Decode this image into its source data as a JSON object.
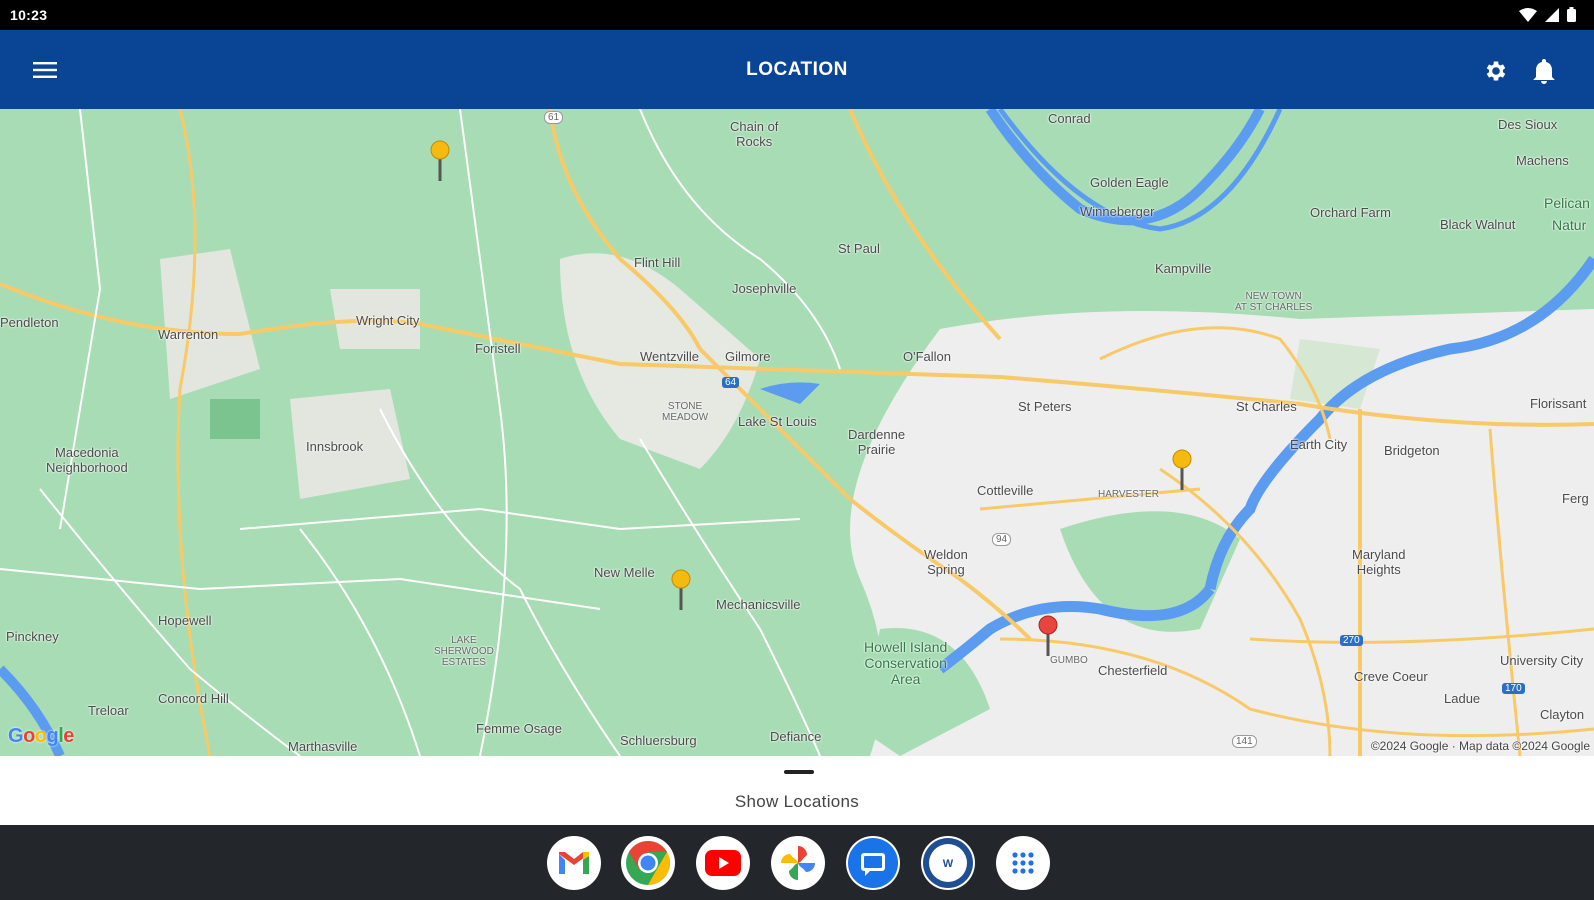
{
  "status_bar": {
    "time": "10:23"
  },
  "app_bar": {
    "title": "LOCATION"
  },
  "map": {
    "labels": {
      "conrad": "Conrad",
      "des_sioux": "Des Sioux",
      "chain_of_rocks": "Chain of\nRocks",
      "golden_eagle": "Golden Eagle",
      "machens": "Machens",
      "winneberger": "Winneberger",
      "orchard_farm": "Orchard Farm",
      "pelican": "Pelican",
      "natur": "Natur",
      "black_walnut": "Black Walnut",
      "st_paul": "St Paul",
      "flint_hill": "Flint Hill",
      "kampville": "Kampville",
      "josephville": "Josephville",
      "new_town": "NEW TOWN\nAT ST CHARLES",
      "pendleton": "Pendleton",
      "warrenton": "Warrenton",
      "wright_city": "Wright City",
      "foristell": "Foristell",
      "wentzville": "Wentzville",
      "gilmore": "Gilmore",
      "ofallon": "O'Fallon",
      "st_peters": "St Peters",
      "st_charles": "St Charles",
      "florissant": "Florissant",
      "stone_meadow": "STONE\nMEADOW",
      "lake_st_louis": "Lake St Louis",
      "dardenne_prairie": "Dardenne\nPrairie",
      "innsbrook": "Innsbrook",
      "macedonia": "Macedonia\nNeighborhood",
      "earth_city": "Earth City",
      "bridgeton": "Bridgeton",
      "cottleville": "Cottleville",
      "harvester": "HARVESTER",
      "ferg": "Ferg",
      "weldon_spring": "Weldon\nSpring",
      "maryland_heights": "Maryland\nHeights",
      "new_melle": "New Melle",
      "mechanicsville": "Mechanicsville",
      "pinckney": "Pinckney",
      "hopewell": "Hopewell",
      "lake_sherwood": "LAKE\nSHERWOOD\nESTATES",
      "howell_island": "Howell Island\nConservation\nArea",
      "university_city": "University City",
      "chesterfield": "Chesterfield",
      "creve_coeur": "Creve Coeur",
      "ladue": "Ladue",
      "clayton": "Clayton",
      "treloar": "Treloar",
      "concord_hill": "Concord Hill",
      "femme_osage": "Femme Osage",
      "schluersburg": "Schluersburg",
      "defiance": "Defiance",
      "marthasville": "Marthasville",
      "gumbo": "GUMBO",
      "route_61": "61",
      "route_64": "64",
      "route_94": "94",
      "route_270": "270",
      "route_170": "170",
      "route_141": "141"
    },
    "google_logo": "Google",
    "copyright": "©2024 Google · Map data ©2024 Google"
  },
  "bottom_sheet": {
    "label": "Show Locations"
  },
  "dock": {
    "apps": [
      "Gmail",
      "Chrome",
      "YouTube",
      "Photos",
      "Messages",
      "Shop app",
      "App drawer"
    ]
  },
  "colors": {
    "app_bar": "#0a4595",
    "map_green": "#a8dcb5",
    "road": "#f8c967",
    "water": "#5b9cf0",
    "pin_yellow": "#f5b90f",
    "pin_red": "#e8453c"
  }
}
